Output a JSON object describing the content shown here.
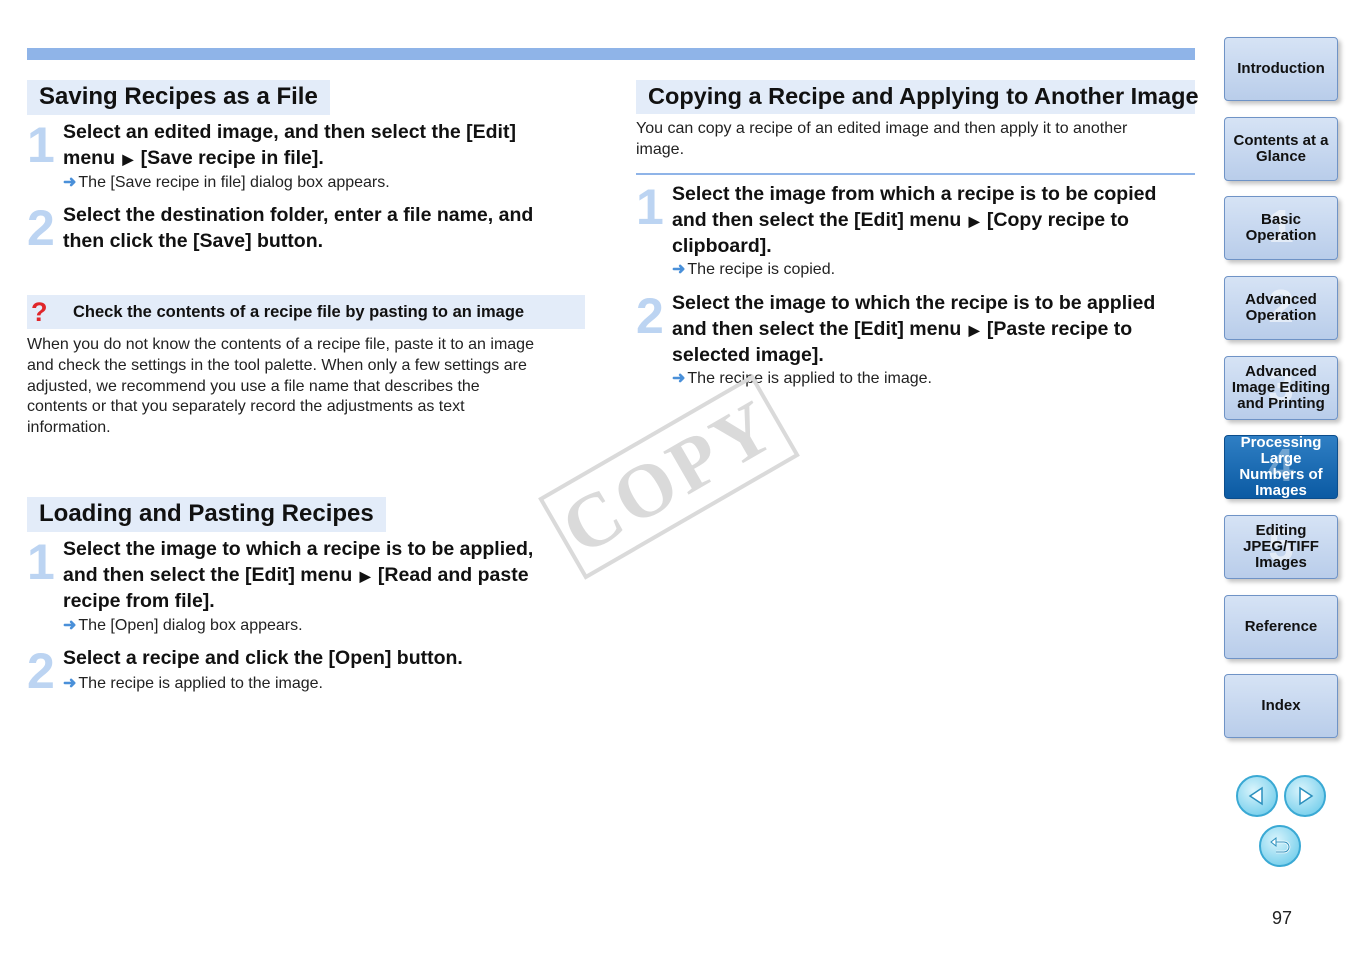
{
  "sections": {
    "saving": {
      "title": "Saving Recipes as a File",
      "steps": [
        {
          "num": "1",
          "line1": "Select an edited image, and then select the [Edit]",
          "line2a": "menu",
          "line2b": "[Save recipe in file].",
          "result": "The [Save recipe in file] dialog box appears."
        },
        {
          "num": "2",
          "line1": "Select the destination folder, enter a file name, and",
          "line2": "then click the [Save] button."
        }
      ]
    },
    "tip": {
      "title": "Check the contents of a recipe file by pasting to an image",
      "icon": "?",
      "lines": [
        "When you do not know the contents of a recipe file, paste it to an image",
        "and check the settings in the tool palette. When only a few settings are",
        "adjusted, we recommend you use a file name that describes the",
        "contents or that you separately record the adjustments as text",
        "information."
      ]
    },
    "loading": {
      "title": "Loading and Pasting Recipes",
      "steps": [
        {
          "num": "1",
          "line1": "Select the image to which a recipe is to be applied,",
          "line2a": "and then select the [Edit] menu",
          "line2b": "[Read and paste",
          "line3": "recipe from file].",
          "result": "The [Open] dialog box appears."
        },
        {
          "num": "2",
          "line1": "Select a recipe and click the [Open] button.",
          "result": "The recipe is applied to the image."
        }
      ]
    },
    "copying": {
      "title": "Copying a Recipe and Applying to Another Image",
      "intro1": "You can copy a recipe of an edited image and then apply it to another",
      "intro2": "image.",
      "steps": [
        {
          "num": "1",
          "line1": "Select the image from which a recipe is to be copied",
          "line2a": "and then select the [Edit] menu",
          "line2b": "[Copy recipe to",
          "line3": "clipboard].",
          "result": "The recipe is copied."
        },
        {
          "num": "2",
          "line1": "Select the image to which the recipe is to be applied",
          "line2a": "and then select the [Edit] menu",
          "line2b": "[Paste recipe to",
          "line3": "selected image].",
          "result": "The recipe is applied to the image."
        }
      ]
    }
  },
  "watermark": "COPY",
  "nav": [
    {
      "label": "Introduction",
      "ghost": ""
    },
    {
      "label": "Contents at a Glance",
      "ghost": ""
    },
    {
      "label": "Basic Operation",
      "ghost": "1"
    },
    {
      "label": "Advanced Operation",
      "ghost": "2"
    },
    {
      "label": "Advanced Image Editing and Printing",
      "ghost": "3"
    },
    {
      "label": "Processing Large Numbers of Images",
      "ghost": "4",
      "active": true
    },
    {
      "label": "Editing JPEG/TIFF Images",
      "ghost": "5"
    },
    {
      "label": "Reference",
      "ghost": ""
    },
    {
      "label": "Index",
      "ghost": ""
    }
  ],
  "page_number": "97",
  "colors": {
    "accent": "#8fb4e8",
    "title_bg": "#e3ecf9",
    "active_nav": "#0b5aa3",
    "tip_icon": "#e0262a"
  }
}
